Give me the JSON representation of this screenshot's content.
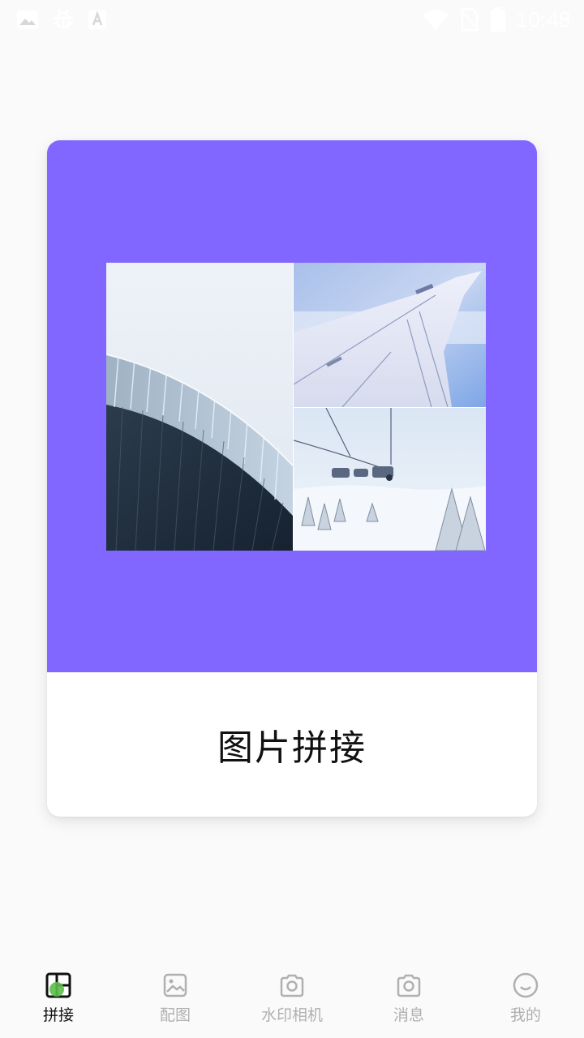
{
  "status_bar": {
    "time": "10:48",
    "left_icons": [
      "image-icon",
      "bug-icon",
      "android-a-icon"
    ],
    "right_icons": [
      "wifi-icon",
      "no-sim-icon",
      "battery-icon"
    ]
  },
  "card": {
    "title": "图片拼接",
    "banner_color": "#8167ff"
  },
  "bottom_nav": {
    "active_index": 0,
    "items": [
      {
        "label": "拼接",
        "icon": "collage-icon"
      },
      {
        "label": "配图",
        "icon": "picture-icon"
      },
      {
        "label": "水印相机",
        "icon": "camera-icon"
      },
      {
        "label": "消息",
        "icon": "camera-icon"
      },
      {
        "label": "我的",
        "icon": "smile-icon"
      }
    ]
  }
}
